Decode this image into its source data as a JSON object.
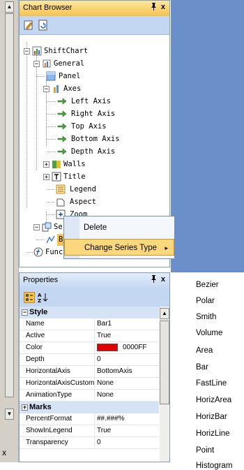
{
  "chart_browser": {
    "title": "Chart Browser",
    "pin": " ",
    "close": "x",
    "tree": {
      "root": "ShiftChart",
      "general": "General",
      "panel": "Panel",
      "axes": "Axes",
      "left_axis": "Left Axis",
      "right_axis": "Right Axis",
      "top_axis": "Top Axis",
      "bottom_axis": "Bottom Axis",
      "depth_axis": "Depth Axis",
      "walls": "Walls",
      "title": "Title",
      "legend": "Legend",
      "aspect": "Aspect",
      "zoom": "Zoom",
      "series": "Series",
      "series_item": "B",
      "functions": "Func"
    }
  },
  "properties": {
    "title": "Properties",
    "pin": " ",
    "close": "x",
    "categories": {
      "style": "Style",
      "marks": "Marks"
    },
    "style_rows": [
      {
        "name": "Name",
        "value": "Bar1"
      },
      {
        "name": "Active",
        "value": "True"
      },
      {
        "name": "Color",
        "value": "0000FF"
      },
      {
        "name": "Depth",
        "value": "0"
      },
      {
        "name": "HorizontalAxis",
        "value": "BottomAxis"
      },
      {
        "name": "HorizontalAxisCustom",
        "value": "None"
      },
      {
        "name": "AnimationType",
        "value": "None"
      }
    ],
    "marks_rows": [
      {
        "name": "PercentFormat",
        "value": "##.###%"
      },
      {
        "name": "ShowInLegend",
        "value": "True"
      },
      {
        "name": "Transparency",
        "value": "0"
      }
    ],
    "color_swatch": "#e00000"
  },
  "context_menu": {
    "delete": "Delete",
    "change_series_type": "Change Series Type",
    "arrow": "▸"
  },
  "submenu": {
    "items": [
      "Bezier",
      "Polar",
      "Smith",
      "Volume",
      "Area",
      "Bar",
      "FastLine",
      "HorizArea",
      "HorizBar",
      "HorizLine",
      "Point",
      "Histogram"
    ]
  },
  "bottom_x": "x",
  "colors": {
    "header": "#f6c24e",
    "toolbar": "#c4d7f2",
    "desktop": "#6b8fc9",
    "highlight": "#fbd77e"
  }
}
